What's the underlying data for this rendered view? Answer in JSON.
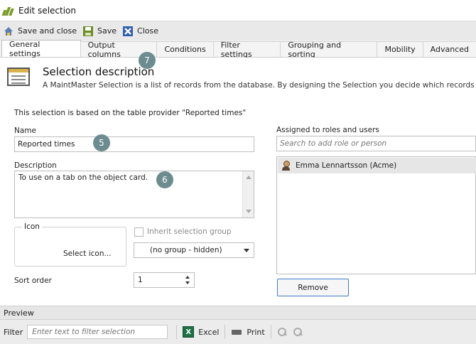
{
  "window": {
    "title": "Edit selection"
  },
  "toolbar": {
    "save_close_label": "Save and close",
    "save_label": "Save",
    "close_label": "Close"
  },
  "tabs": [
    {
      "label": "General settings",
      "active": true
    },
    {
      "label": "Output columns"
    },
    {
      "label": "Conditions"
    },
    {
      "label": "Filter settings"
    },
    {
      "label": "Grouping and sorting"
    },
    {
      "label": "Mobility"
    },
    {
      "label": "Advanced"
    }
  ],
  "header": {
    "title": "Selection description",
    "description": "A MaintMaster Selection is a list of records from the database. By designing the Selection you decide which records will"
  },
  "form": {
    "based_on": "This selection is based on the table provider \"Reported times\"",
    "name_label": "Name",
    "name_value": "Reported times",
    "description_label": "Description",
    "description_value": "To use on a tab on the object card.",
    "icon_label": "Icon",
    "select_icon_label": "Select icon...",
    "inherit_label": "Inherit selection group",
    "group_value": "(no group - hidden)",
    "sort_order_label": "Sort order",
    "sort_order_value": "1"
  },
  "roles": {
    "label": "Assigned to roles and users",
    "search_placeholder": "Search to add role or person",
    "items": [
      {
        "name": "Emma Lennartsson (Acme)"
      }
    ],
    "remove_label": "Remove"
  },
  "badges": {
    "name": "5",
    "description": "6",
    "output_columns": "7"
  },
  "preview": {
    "label": "Preview"
  },
  "filter": {
    "label": "Filter",
    "placeholder": "Enter text to filter selection",
    "excel_label": "Excel",
    "print_label": "Print"
  },
  "colors": {
    "accent": "#3b7ac9",
    "badge": "#6d8c8f",
    "toolbar": "#e9e9e9"
  }
}
